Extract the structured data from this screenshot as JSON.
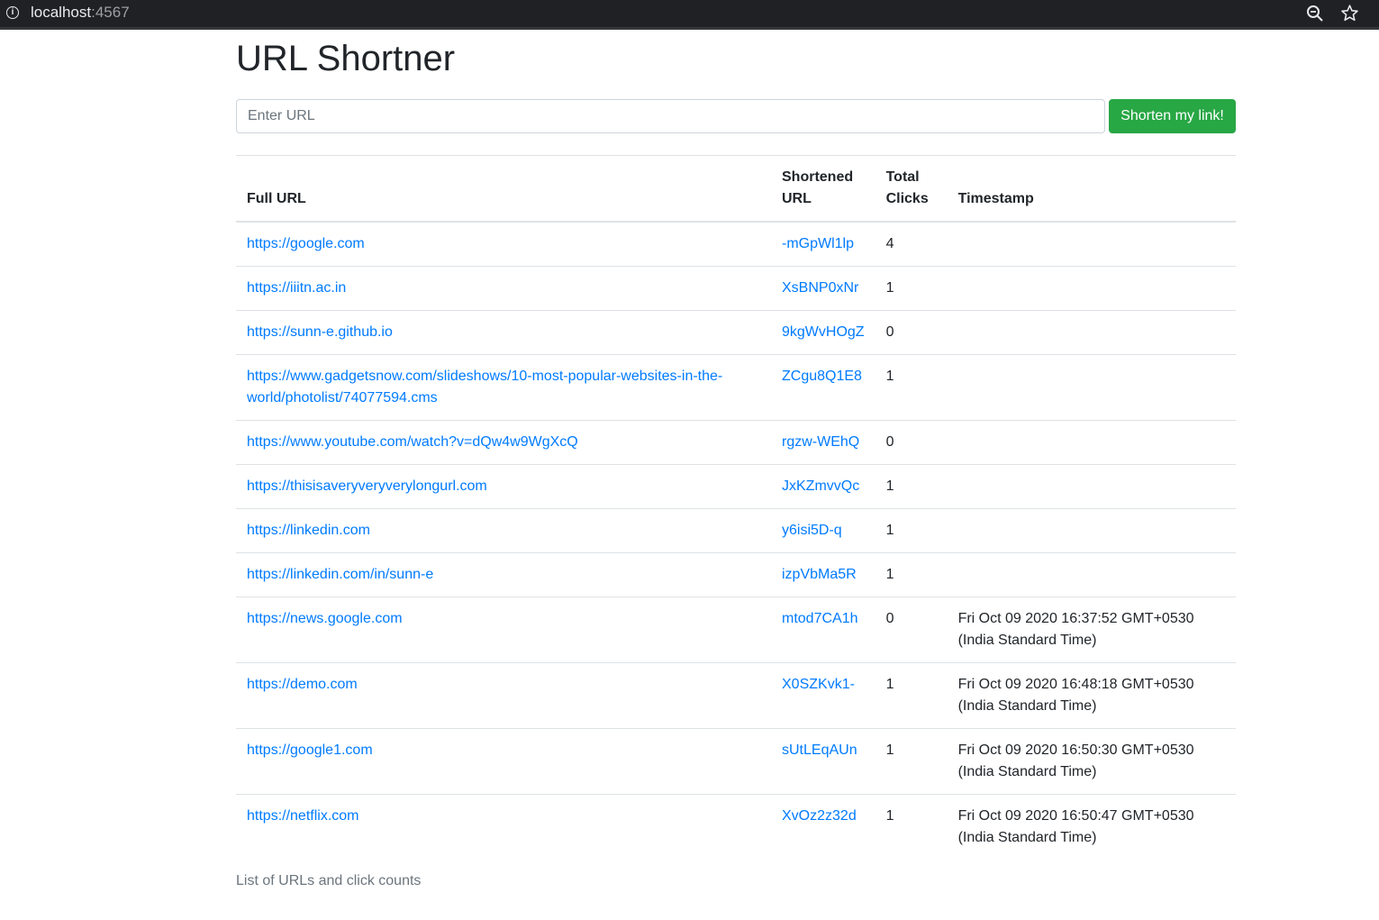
{
  "browser": {
    "host": "localhost",
    "port": ":4567"
  },
  "page": {
    "title": "URL Shortner"
  },
  "form": {
    "placeholder": "Enter URL",
    "button_label": "Shorten my link!"
  },
  "table": {
    "headers": {
      "full_url": "Full URL",
      "shortened_url": "Shortened URL",
      "total_clicks": "Total Clicks",
      "timestamp": "Timestamp"
    },
    "rows": [
      {
        "full": "https://google.com",
        "short": "-mGpWl1lp",
        "clicks": "4",
        "timestamp": ""
      },
      {
        "full": "https://iiitn.ac.in",
        "short": "XsBNP0xNr",
        "clicks": "1",
        "timestamp": ""
      },
      {
        "full": "https://sunn-e.github.io",
        "short": "9kgWvHOgZ",
        "clicks": "0",
        "timestamp": ""
      },
      {
        "full": "https://www.gadgetsnow.com/slideshows/10-most-popular-websites-in-the-world/photolist/74077594.cms",
        "short": "ZCgu8Q1E8",
        "clicks": "1",
        "timestamp": ""
      },
      {
        "full": "https://www.youtube.com/watch?v=dQw4w9WgXcQ",
        "short": "rgzw-WEhQ",
        "clicks": "0",
        "timestamp": ""
      },
      {
        "full": "https://thisisaveryveryverylongurl.com",
        "short": "JxKZmvvQc",
        "clicks": "1",
        "timestamp": ""
      },
      {
        "full": "https://linkedin.com",
        "short": "y6isi5D-q",
        "clicks": "1",
        "timestamp": ""
      },
      {
        "full": "https://linkedin.com/in/sunn-e",
        "short": "izpVbMa5R",
        "clicks": "1",
        "timestamp": ""
      },
      {
        "full": "https://news.google.com",
        "short": "mtod7CA1h",
        "clicks": "0",
        "timestamp": "Fri Oct 09 2020 16:37:52 GMT+0530 (India Standard Time)"
      },
      {
        "full": "https://demo.com",
        "short": "X0SZKvk1-",
        "clicks": "1",
        "timestamp": "Fri Oct 09 2020 16:48:18 GMT+0530 (India Standard Time)"
      },
      {
        "full": "https://google1.com",
        "short": "sUtLEqAUn",
        "clicks": "1",
        "timestamp": "Fri Oct 09 2020 16:50:30 GMT+0530 (India Standard Time)"
      },
      {
        "full": "https://netflix.com",
        "short": "XvOz2z32d",
        "clicks": "1",
        "timestamp": "Fri Oct 09 2020 16:50:47 GMT+0530 (India Standard Time)"
      }
    ],
    "caption": "List of URLs and click counts"
  },
  "colors": {
    "link": "#007bff",
    "button": "#28a745",
    "browser_bar": "#202124"
  },
  "icons": {
    "info": "info-icon",
    "zoom": "zoom-icon",
    "star": "star-icon"
  }
}
